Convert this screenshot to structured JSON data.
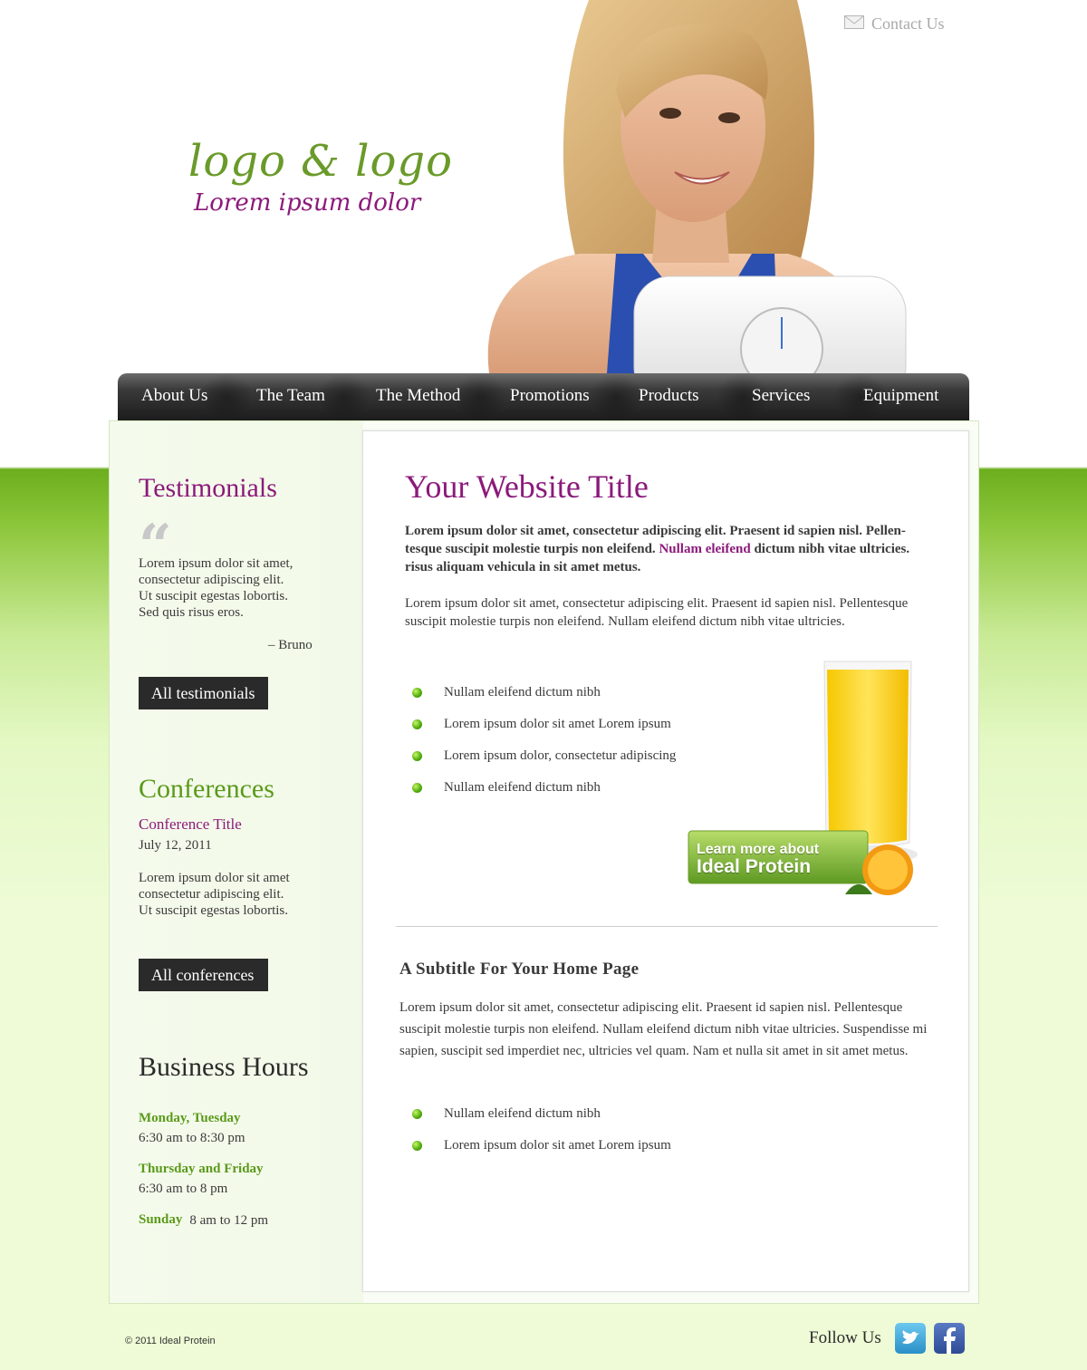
{
  "header": {
    "contact_label": "Contact Us",
    "logo_main": "logo & logo",
    "logo_tagline": "Lorem ipsum dolor"
  },
  "nav": [
    "About Us",
    "The Team",
    "The Method",
    "Promotions",
    "Products",
    "Services",
    "Equipment"
  ],
  "sidebar": {
    "testimonials": {
      "title": "Testimonials",
      "quote_lines": [
        "Lorem ipsum dolor sit amet,",
        "consectetur adipiscing elit.",
        "Ut suscipit egestas lobortis.",
        "Sed quis risus eros."
      ],
      "author": "– Bruno",
      "button": "All testimonials"
    },
    "conferences": {
      "title": "Conferences",
      "item_title": "Conference Title",
      "date": "July 12, 2011",
      "text_lines": [
        "Lorem ipsum dolor sit amet",
        "consectetur adipiscing elit.",
        "Ut suscipit egestas lobortis."
      ],
      "button": "All conferences"
    },
    "hours": {
      "title": "Business Hours",
      "rows": [
        {
          "days": "Monday, Tuesday",
          "time": "6:30 am to 8:30 pm"
        },
        {
          "days": "Thursday and Friday",
          "time": "6:30 am to 8 pm"
        },
        {
          "days": "Sunday",
          "time": "8 am to 12 pm"
        }
      ]
    }
  },
  "main": {
    "title": "Your Website Title",
    "intro_bold_1": "Lorem ipsum dolor sit amet, consectetur adipiscing elit. Praesent id sapien nisl. Pellen-",
    "intro_bold_2a": "tesque suscipit molestie turpis non eleifend. ",
    "intro_bold_2_link": "Nullam eleifend",
    "intro_bold_2b": " dictum nibh vitae ultricies.",
    "intro_bold_3": "risus aliquam vehicula in sit amet metus.",
    "para_1": "Lorem ipsum dolor sit amet, consectetur adipiscing elit. Praesent id sapien nisl. Pellentesque",
    "para_2": "suscipit molestie turpis non eleifend. Nullam eleifend dictum nibh vitae ultricies.",
    "bullets": [
      "Nullam eleifend dictum nibh",
      "Lorem ipsum dolor sit amet Lorem ipsum",
      "Lorem ipsum dolor, consectetur adipiscing",
      "Nullam eleifend dictum nibh"
    ],
    "promo_line1": "Learn more about",
    "promo_line2": "Ideal Protein",
    "subtitle": "A Subtitle For Your Home Page",
    "sub_para_1": "Lorem ipsum dolor sit amet, consectetur adipiscing elit. Praesent id sapien nisl. Pellentesque",
    "sub_para_2": "suscipit molestie turpis non eleifend. Nullam eleifend dictum nibh vitae ultricies. Suspendisse mi",
    "sub_para_3": "sapien, suscipit sed imperdiet nec, ultricies vel quam. Nam et nulla sit amet in sit amet metus.",
    "sub_bullets": [
      "Nullam eleifend dictum nibh",
      "Lorem ipsum dolor sit amet Lorem ipsum"
    ]
  },
  "footer": {
    "copyright": "© 2011 Ideal Protein",
    "follow": "Follow Us",
    "social_icons": [
      "twitter-icon",
      "facebook-icon"
    ]
  },
  "colors": {
    "purple": "#8b1a7a",
    "green": "#5a9a1a",
    "nav_dark": "#1c1c1c",
    "bg_green": "#8cc63a"
  }
}
